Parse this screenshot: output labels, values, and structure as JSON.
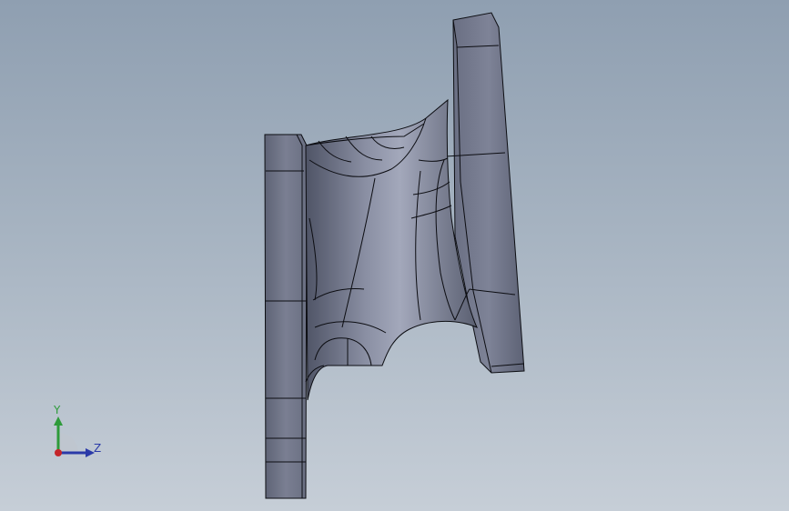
{
  "viewport": {
    "background_top": "#8f9fb1",
    "background_bottom": "#c6ced7",
    "model_color": "#6f7486",
    "edge_color": "#0c0d12"
  },
  "triad": {
    "y_label": "Y",
    "z_label": "Z",
    "y_color": "#2e9b3a",
    "z_color": "#2a3aa8",
    "x_color": "#c4252a",
    "icons": [
      "y-axis-arrow-icon",
      "z-axis-arrow-icon",
      "origin-icon"
    ]
  }
}
